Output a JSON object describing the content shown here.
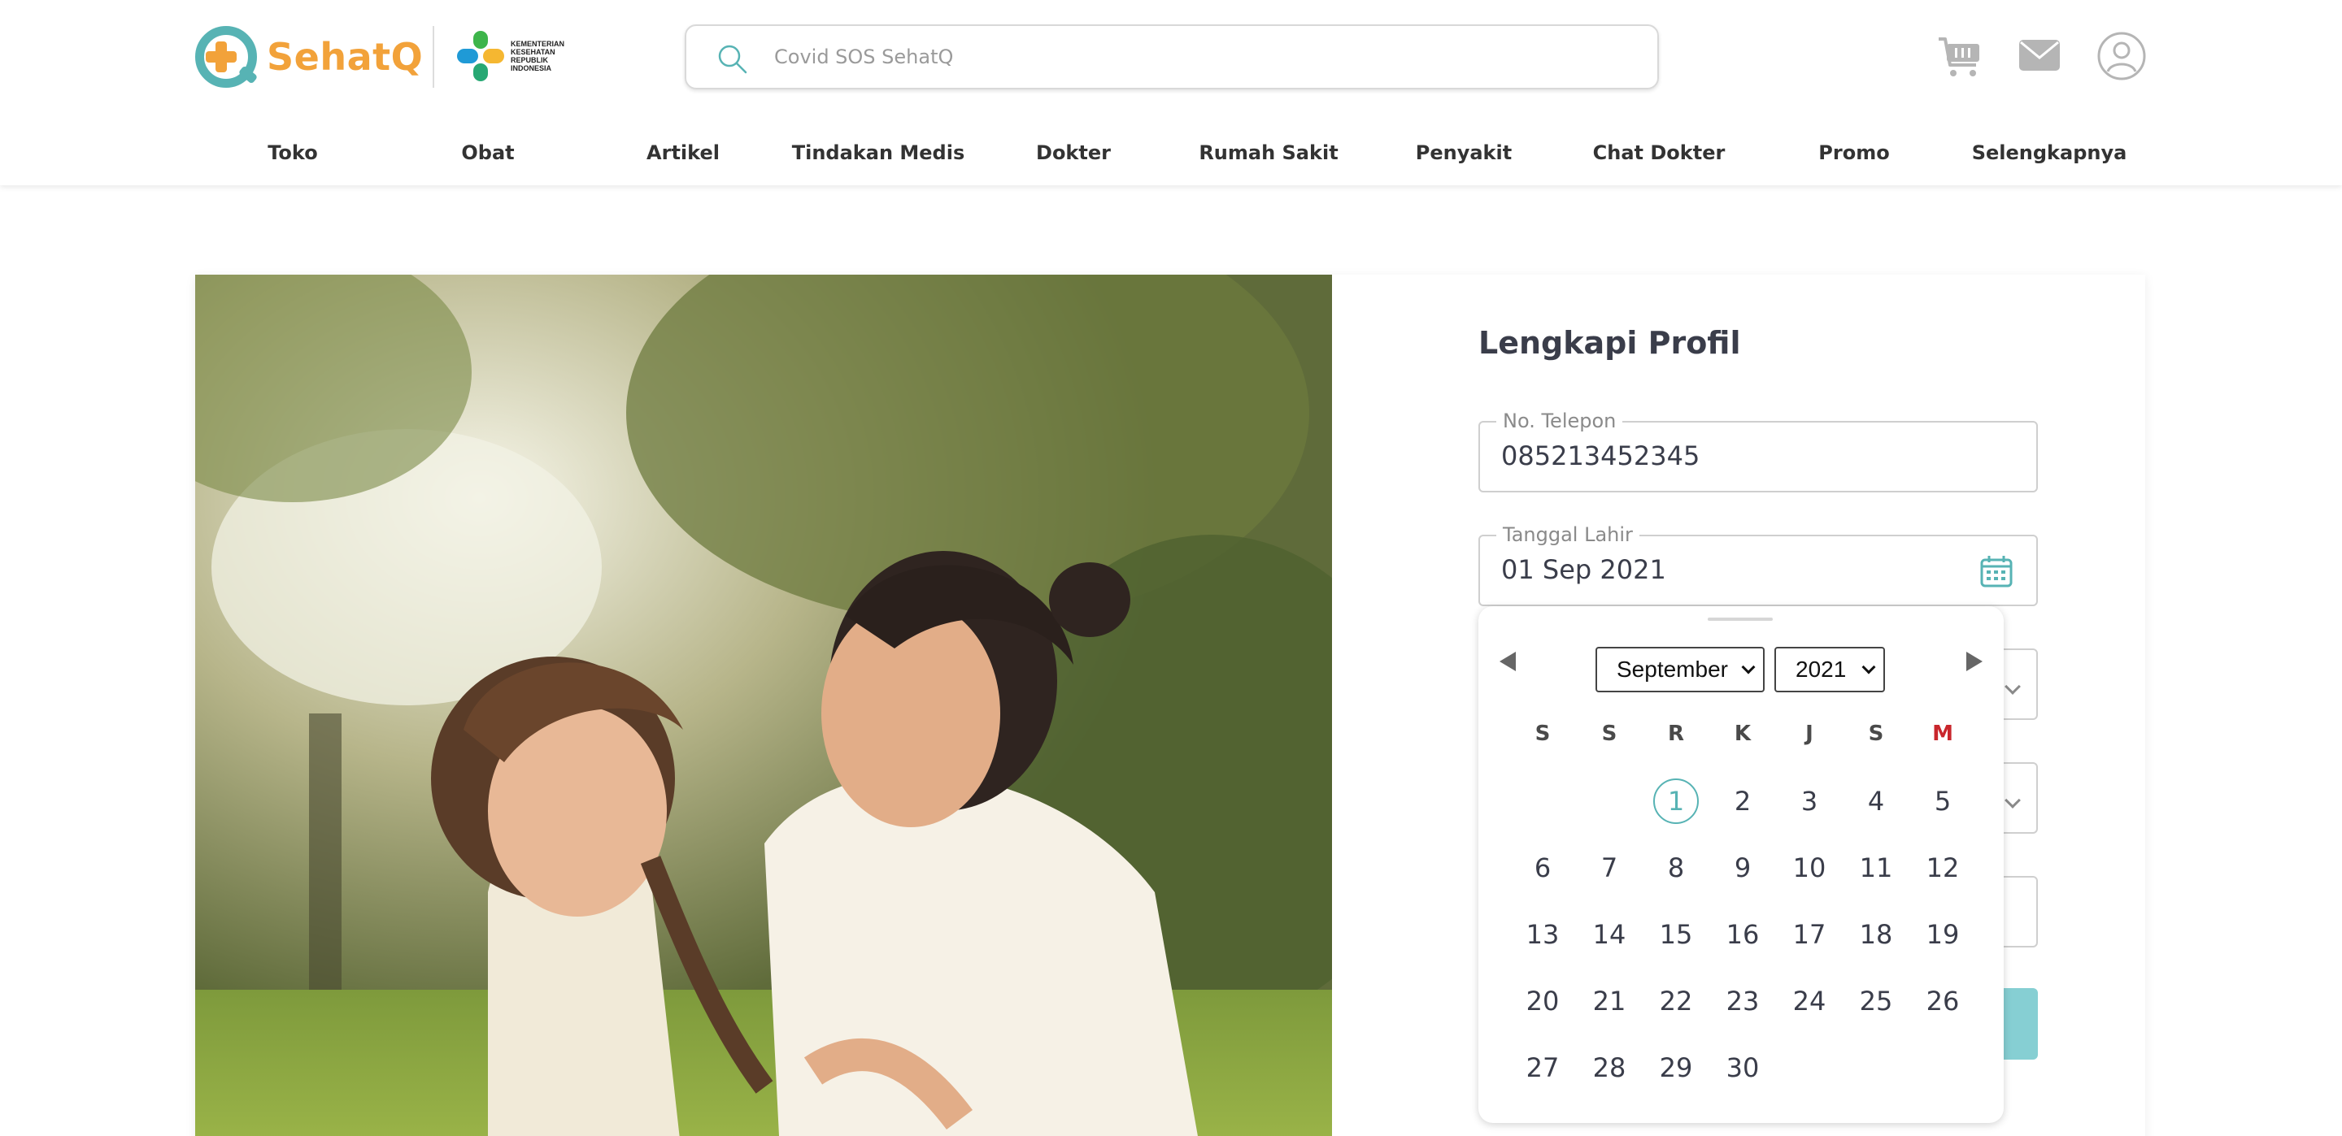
{
  "brand": {
    "name": "SehatQ",
    "partner_lines": [
      "KEMENTERIAN",
      "KESEHATAN",
      "REPUBLIK",
      "INDONESIA"
    ],
    "accent_color": "#57b3b4",
    "brand_color": "#f2a23a"
  },
  "search": {
    "placeholder": "Covid SOS SehatQ",
    "value": ""
  },
  "header_icons": [
    "cart-icon",
    "mail-icon",
    "user-icon"
  ],
  "nav": {
    "items": [
      "Toko",
      "Obat",
      "Artikel",
      "Tindakan Medis",
      "Dokter",
      "Rumah Sakit",
      "Penyakit",
      "Chat Dokter",
      "Promo",
      "Selengkapnya"
    ]
  },
  "form": {
    "title": "Lengkapi Profil",
    "phone": {
      "label": "No. Telepon",
      "value": "085213452345"
    },
    "birthdate": {
      "label": "Tanggal Lahir",
      "value": "01 Sep 2021"
    }
  },
  "datepicker": {
    "month": "September",
    "year": "2021",
    "weekdays": [
      "S",
      "S",
      "R",
      "K",
      "J",
      "S",
      "M"
    ],
    "first_weekday_index": 2,
    "days_in_month": 30,
    "selected_day": 1,
    "sunday_color": "#c9262c"
  }
}
